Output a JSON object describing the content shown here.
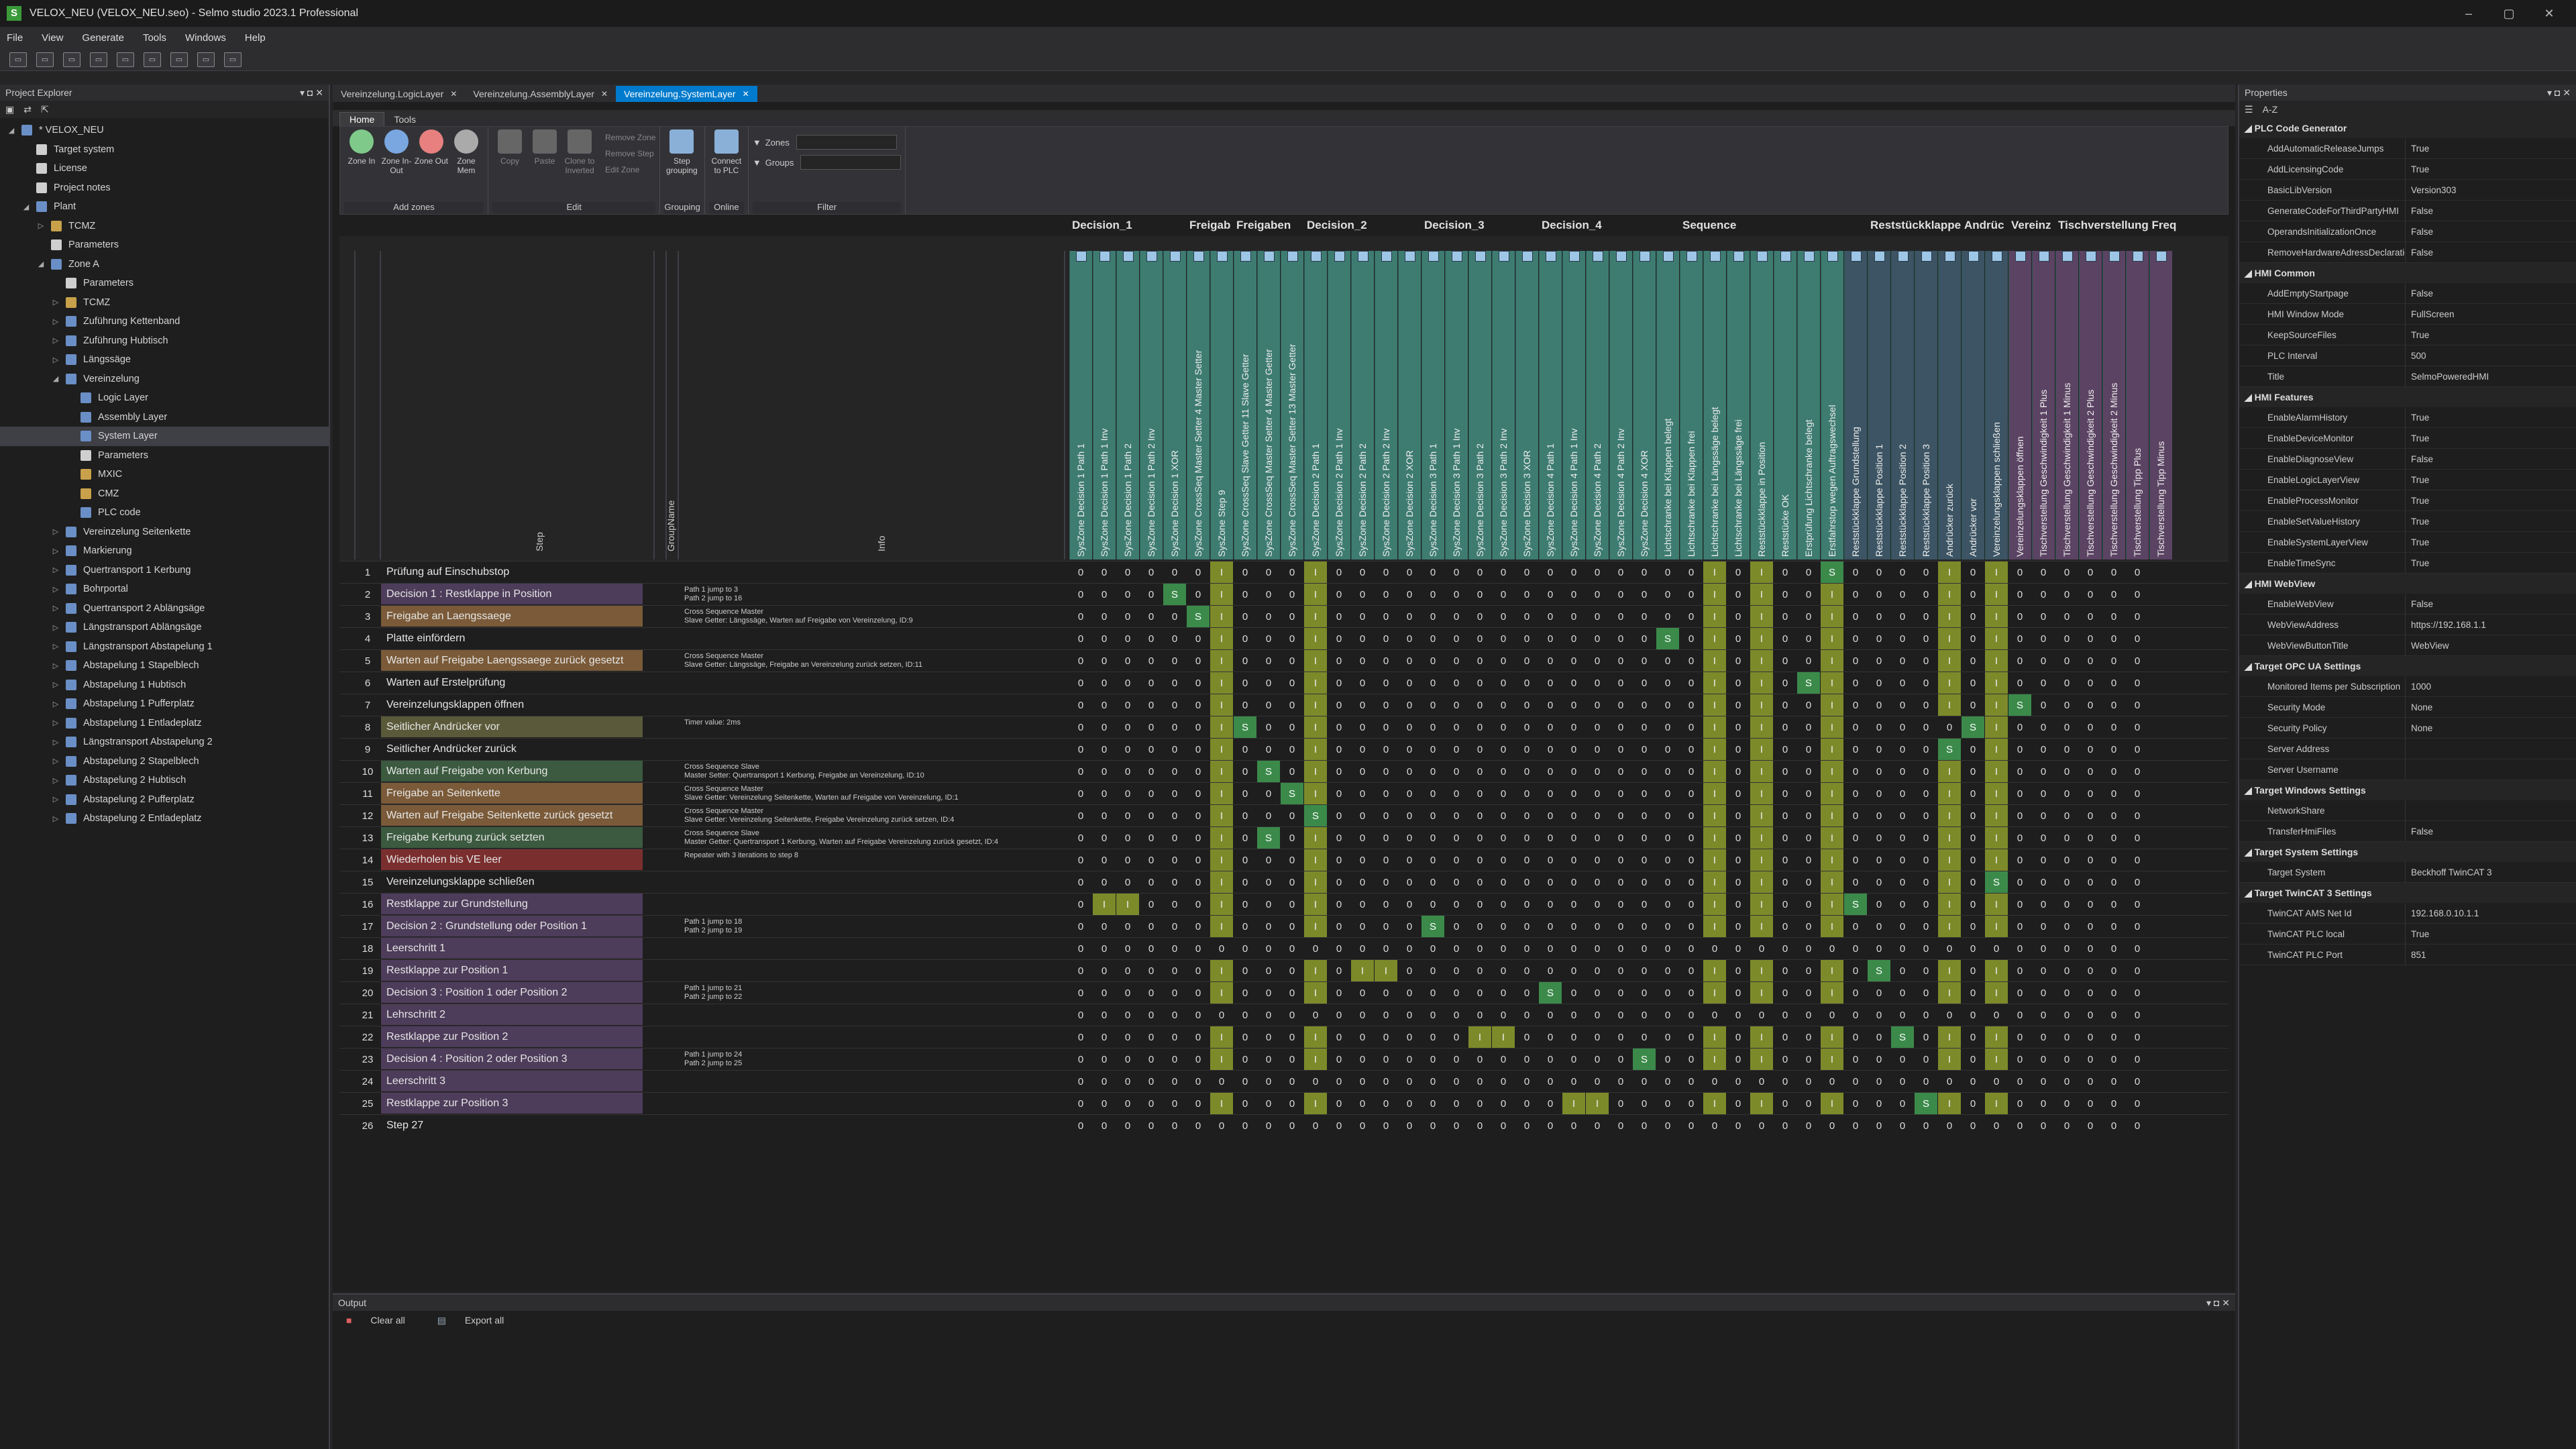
{
  "app": {
    "title": "VELOX_NEU (VELOX_NEU.seo) - Selmo studio 2023.1 Professional",
    "menu": [
      "File",
      "View",
      "Generate",
      "Tools",
      "Windows",
      "Help"
    ]
  },
  "explorer": {
    "title": "Project Explorer",
    "tree": [
      {
        "label": "* VELOX_NEU",
        "depth": 0,
        "icon": "project",
        "arrow": "expanded"
      },
      {
        "label": "Target system",
        "depth": 1,
        "icon": "doc"
      },
      {
        "label": "License",
        "depth": 1,
        "icon": "doc"
      },
      {
        "label": "Project notes",
        "depth": 1,
        "icon": "doc"
      },
      {
        "label": "Plant",
        "depth": 1,
        "icon": "plant",
        "arrow": "expanded"
      },
      {
        "label": "TCMZ",
        "depth": 2,
        "icon": "folder",
        "arrow": "collapsed"
      },
      {
        "label": "Parameters",
        "depth": 2,
        "icon": "sq"
      },
      {
        "label": "Zone A",
        "depth": 2,
        "icon": "zone",
        "arrow": "expanded"
      },
      {
        "label": "Parameters",
        "depth": 3,
        "icon": "sq"
      },
      {
        "label": "TCMZ",
        "depth": 3,
        "icon": "folder",
        "arrow": "collapsed"
      },
      {
        "label": "Zuführung Kettenband",
        "depth": 3,
        "icon": "zone",
        "arrow": "collapsed"
      },
      {
        "label": "Zuführung Hubtisch",
        "depth": 3,
        "icon": "zone",
        "arrow": "collapsed"
      },
      {
        "label": "Längssäge",
        "depth": 3,
        "icon": "zone",
        "arrow": "collapsed"
      },
      {
        "label": "Vereinzelung",
        "depth": 3,
        "icon": "zone",
        "arrow": "expanded"
      },
      {
        "label": "Logic Layer",
        "depth": 4,
        "icon": "layer"
      },
      {
        "label": "Assembly Layer",
        "depth": 4,
        "icon": "layer"
      },
      {
        "label": "System Layer",
        "depth": 4,
        "icon": "layer",
        "selected": true
      },
      {
        "label": "Parameters",
        "depth": 4,
        "icon": "sq"
      },
      {
        "label": "MXIC",
        "depth": 4,
        "icon": "folder"
      },
      {
        "label": "CMZ",
        "depth": 4,
        "icon": "folder"
      },
      {
        "label": "PLC code",
        "depth": 4,
        "icon": "layer"
      },
      {
        "label": "Vereinzelung Seitenkette",
        "depth": 3,
        "icon": "zone",
        "arrow": "collapsed"
      },
      {
        "label": "Markierung",
        "depth": 3,
        "icon": "zone",
        "arrow": "collapsed"
      },
      {
        "label": "Quertransport 1 Kerbung",
        "depth": 3,
        "icon": "zone",
        "arrow": "collapsed"
      },
      {
        "label": "Bohrportal",
        "depth": 3,
        "icon": "zone",
        "arrow": "collapsed"
      },
      {
        "label": "Quertransport 2 Ablängsäge",
        "depth": 3,
        "icon": "zone",
        "arrow": "collapsed"
      },
      {
        "label": "Längstransport Ablängsäge",
        "depth": 3,
        "icon": "zone",
        "arrow": "collapsed"
      },
      {
        "label": "Längstransport Abstapelung 1",
        "depth": 3,
        "icon": "zone",
        "arrow": "collapsed"
      },
      {
        "label": "Abstapelung 1 Stapelblech",
        "depth": 3,
        "icon": "zone",
        "arrow": "collapsed"
      },
      {
        "label": "Abstapelung 1 Hubtisch",
        "depth": 3,
        "icon": "zone",
        "arrow": "collapsed"
      },
      {
        "label": "Abstapelung 1 Pufferplatz",
        "depth": 3,
        "icon": "zone",
        "arrow": "collapsed"
      },
      {
        "label": "Abstapelung 1 Entladeplatz",
        "depth": 3,
        "icon": "zone",
        "arrow": "collapsed"
      },
      {
        "label": "Längstransport Abstapelung 2",
        "depth": 3,
        "icon": "zone",
        "arrow": "collapsed"
      },
      {
        "label": "Abstapelung 2 Stapelblech",
        "depth": 3,
        "icon": "zone",
        "arrow": "collapsed"
      },
      {
        "label": "Abstapelung 2 Hubtisch",
        "depth": 3,
        "icon": "zone",
        "arrow": "collapsed"
      },
      {
        "label": "Abstapelung 2 Pufferplatz",
        "depth": 3,
        "icon": "zone",
        "arrow": "collapsed"
      },
      {
        "label": "Abstapelung 2 Entladeplatz",
        "depth": 3,
        "icon": "zone",
        "arrow": "collapsed"
      }
    ]
  },
  "tabs": [
    {
      "label": "Vereinzelung.LogicLayer"
    },
    {
      "label": "Vereinzelung.AssemblyLayer"
    },
    {
      "label": "Vereinzelung.SystemLayer",
      "active": true
    }
  ],
  "ribbon": {
    "tabs": [
      "Home",
      "Tools"
    ],
    "groups": [
      {
        "label": "Add zones",
        "buttons": [
          {
            "label": "Zone In",
            "color": "#7fc98a"
          },
          {
            "label": "Zone In-Out",
            "color": "#7aa7e0"
          },
          {
            "label": "Zone Out",
            "color": "#e88080"
          },
          {
            "label": "Zone Mem",
            "color": "#aaaaaa"
          }
        ]
      },
      {
        "label": "Edit",
        "buttons": [
          {
            "label": "Copy",
            "color": "#666",
            "disabled": true
          },
          {
            "label": "Paste",
            "color": "#666",
            "disabled": true
          },
          {
            "label": "Clone to Inverted",
            "color": "#666",
            "disabled": true
          }
        ],
        "small": [
          "Remove Zone",
          "Remove Step",
          "Edit Zone"
        ]
      },
      {
        "label": "Grouping",
        "buttons": [
          {
            "label": "Step grouping",
            "color": "#8ab0d8"
          }
        ]
      },
      {
        "label": "Online",
        "buttons": [
          {
            "label": "Connect to PLC",
            "color": "#8ab0d8"
          }
        ]
      },
      {
        "label": "Filter",
        "filters": [
          "Zones",
          "Groups"
        ]
      }
    ]
  },
  "grid": {
    "header_cols": [
      "Step",
      "GroupName",
      "Info"
    ],
    "groups": [
      {
        "name": "Decision_1",
        "span": 5
      },
      {
        "name": "Freigab",
        "span": 2
      },
      {
        "name": "Freigaben",
        "span": 3
      },
      {
        "name": "Decision_2",
        "span": 5
      },
      {
        "name": "Decision_3",
        "span": 5
      },
      {
        "name": "Decision_4",
        "span": 6
      },
      {
        "name": "Sequence",
        "span": 8
      },
      {
        "name": "Reststückklappe",
        "span": 4
      },
      {
        "name": "Andrüc",
        "span": 2
      },
      {
        "name": "Vereinz",
        "span": 2
      },
      {
        "name": "Tischverstellung Freq",
        "span": 6
      }
    ],
    "columns": [
      "SysZone Decision 1 Path 1",
      "SysZone Decision 1 Path 1 Inv",
      "SysZone Decision 1 Path 2",
      "SysZone Decision 1 Path 2 Inv",
      "SysZone Decision 1 XOR",
      "SysZone CrossSeq Master Setter 4 Master Setter",
      "SysZone Step 9",
      "SysZone CrossSeq Slave Getter 11 Slave Getter",
      "SysZone CrossSeq Master Setter 4 Master Getter",
      "SysZone CrossSeq Master Setter 13 Master Getter",
      "SysZone Decision 2 Path 1",
      "SysZone Decision 2 Path 1 Inv",
      "SysZone Decision 2 Path 2",
      "SysZone Decision 2 Path 2 Inv",
      "SysZone Decision 2 XOR",
      "SysZone Decision 3 Path 1",
      "SysZone Decision 3 Path 1 Inv",
      "SysZone Decision 3 Path 2",
      "SysZone Decision 3 Path 2 Inv",
      "SysZone Decision 3 XOR",
      "SysZone Decision 4 Path 1",
      "SysZone Decision 4 Path 1 Inv",
      "SysZone Decision 4 Path 2",
      "SysZone Decision 4 Path 2 Inv",
      "SysZone Decision 4 XOR",
      "Lichtschranke bei Klappen belegt",
      "Lichtschranke bei Klappen frei",
      "Lichtschranke bei Längssäge belegt",
      "Lichtschranke bei Längssäge frei",
      "Reststückklappe in Position",
      "Reststücke OK",
      "Erstprüfung Lichtschranke belegt",
      "Erstfahrstop wegen Auftragswechsel",
      "Reststückklappe Grundstellung",
      "Reststückklappe Position 1",
      "Reststückklappe Position 2",
      "Reststückklappe Position 3",
      "Andrücker zurück",
      "Andrücker vor",
      "Vereinzelungsklappen schließen",
      "Vereinzelungsklappen öffnen",
      "Tischverstellung Geschwindigkeit 1 Plus",
      "Tischverstellung Geschwindigkeit 1 Minus",
      "Tischverstellung Geschwindigkeit 2 Plus",
      "Tischverstellung Geschwindigkeit 2 Minus",
      "Tischverstellung Tipp Plus",
      "Tischverstellung Tipp Minus"
    ],
    "steps": [
      {
        "n": "1",
        "step": "Prüfung auf Einschubstop",
        "kind": "plain",
        "info": "",
        "cells": "OOOOOOIOOOIOOOOOOOOOOOOOOOOIOIOOSOOOOIOIOOOOOO"
      },
      {
        "n": "2",
        "step": "Decision 1 : Restklappe in Position",
        "kind": "decision",
        "info": "Path 1 jump to 3|Path 2 jump to 16",
        "cells": "OOOOSOIOOOIOOOOOOOOOOOOOOOOIOIOOIOOOOIOIOOOOOO"
      },
      {
        "n": "3",
        "step": "Freigabe an Laengssaege",
        "kind": "orange",
        "info": "Cross Sequence Master|Slave Getter: Längssäge, Warten auf Freigabe von Vereinzelung, ID:9",
        "cells": "OOOOOSIOOOIOOOOOOOOOOOOOOOOIOIOOIOOOOIOIOOOOOO"
      },
      {
        "n": "4",
        "step": "Platte einfördern",
        "kind": "plain",
        "info": "",
        "cells": "OOOOOOIOOOIOOOOOOOOOOOOOOSOIOIOOIOOOOIOIOOOOOO"
      },
      {
        "n": "5",
        "step": "Warten auf Freigabe Laengssaege zurück gesetzt",
        "kind": "orange",
        "info": "Cross Sequence Master|Slave Getter: Längssäge, Freigabe an Vereinzelung zurück setzen, ID:11",
        "cells": "OOOOOOIOOOIOOOOOOOOOOOOOOOOIOIOOIOOOOIOIOOOOOO"
      },
      {
        "n": "6",
        "step": "Warten auf Erstelprüfung",
        "kind": "plain",
        "info": "",
        "cells": "OOOOOOIOOOIOOOOOOOOOOOOOOOOIOIOSIOOOOIOIOOOOOO"
      },
      {
        "n": "7",
        "step": "Vereinzelungsklappen öffnen",
        "kind": "plain",
        "info": "",
        "cells": "OOOOOOIOOOIOOOOOOOOOOOOOOOOIOIOOIOOOOIOISOOOOO"
      },
      {
        "n": "8",
        "step": "Seitlicher Andrücker vor",
        "kind": "olive",
        "info": "Timer value: 2ms",
        "cells": "OOOOOOISOOIOOOOOOOOOOOOOOOOIOIOOIOOOOOSIOOOOOO"
      },
      {
        "n": "9",
        "step": "Seitlicher Andrücker zurück",
        "kind": "plain",
        "info": "",
        "cells": "OOOOOOIOOOIOOOOOOOOOOOOOOOOIOIOOIOOOOSOIOOOOOO"
      },
      {
        "n": "10",
        "step": "Warten auf Freigabe von Kerbung",
        "kind": "green",
        "info": "Cross Sequence Slave|Master Setter: Quertransport 1 Kerbung, Freigabe an Vereinzelung, ID:10",
        "cells": "OOOOOOIOSOIOOOOOOOOOOOOOOOOIOIOOIOOOOIOIOOOOOO"
      },
      {
        "n": "11",
        "step": "Freigabe an Seitenkette",
        "kind": "orange",
        "info": "Cross Sequence Master|Slave Getter: Vereinzelung Seitenkette, Warten auf Freigabe von Vereinzelung, ID:1",
        "cells": "OOOOOOIOOSIOOOOOOOOOOOOOOOOIOIOOIOOOOIOIOOOOOO"
      },
      {
        "n": "12",
        "step": "Warten auf Freigabe Seitenkette zurück gesetzt",
        "kind": "orange",
        "info": "Cross Sequence Master|Slave Getter: Vereinzelung Seitenkette, Freigabe Vereinzelung zurück setzen, ID:4",
        "cells": "OOOOOOIOOOSOOOOOOOOOOOOOOOOIOIOOIOOOOIOIOOOOOO"
      },
      {
        "n": "13",
        "step": "Freigabe Kerbung zurück setzten",
        "kind": "green",
        "info": "Cross Sequence Slave|Master Getter: Quertransport 1 Kerbung, Warten auf Freigabe Vereinzelung zurück gesetzt, ID:4",
        "cells": "OOOOOOIOSOIOOOOOOOOOOOOOOOOIOIOOIOOOOIOIOOOOOO"
      },
      {
        "n": "14",
        "step": "Wiederholen bis VE leer",
        "kind": "red",
        "info": "Repeater with 3 iterations to step 8",
        "cells": "OOOOOOIOOOIOOOOOOOOOOOOOOOOIOIOOIOOOOIOIOOOOOO"
      },
      {
        "n": "15",
        "step": "Vereinzelungsklappe schließen",
        "kind": "plain",
        "info": "",
        "cells": "OOOOOOIOOOIOOOOOOOOOOOOOOOOIOIOOIOOOOIOSOOOOOO"
      },
      {
        "n": "16",
        "step": "Restklappe zur Grundstellung",
        "kind": "purple",
        "info": "",
        "cells": "OIIOOOIOOOIOOOOOOOOOOOOOOOOIOIOOISOOOIOIOOOOOO"
      },
      {
        "n": "17",
        "step": "Decision 2 : Grundstellung oder Position 1",
        "kind": "decision",
        "info": "Path 1 jump to 18|Path 2 jump to 19",
        "cells": "OOOOOOIOOOIOOOOSOOOOOOOOOOOIOIOOIOOOOIOIOOOOOO"
      },
      {
        "n": "18",
        "step": "Leerschritt 1",
        "kind": "purple",
        "info": "",
        "cells": "OOOOOOOOOOOOOOOOOOOOOOOOOOOOOOOOOOOOOOOOOOOOOO"
      },
      {
        "n": "19",
        "step": "Restklappe zur Position 1",
        "kind": "purple",
        "info": "",
        "cells": "OOOOOOIOOOIOIIOOOOOOOOOOOOOIOIOOIOSOOIOIOOOOOO"
      },
      {
        "n": "20",
        "step": "Decision 3 : Position 1 oder Position 2",
        "kind": "decision",
        "info": "Path 1 jump to 21|Path 2 jump to 22",
        "cells": "OOOOOOIOOOIOOOOOOOOOSOOOOOOIOIOOIOOOOIOIOOOOOO"
      },
      {
        "n": "21",
        "step": "Lehrschritt 2",
        "kind": "purple",
        "info": "",
        "cells": "OOOOOOOOOOOOOOOOOOOOOOOOOOOOOOOOOOOOOOOOOOOOOO"
      },
      {
        "n": "22",
        "step": "Restklappe zur Position 2",
        "kind": "purple",
        "info": "",
        "cells": "OOOOOOIOOOIOOOOOOIIOOOOOOOOIOIOOIOOSOIOIOOOOOO"
      },
      {
        "n": "23",
        "step": "Decision 4 : Position 2 oder Position 3",
        "kind": "decision",
        "info": "Path 1 jump to 24|Path 2 jump to 25",
        "cells": "OOOOOOIOOOIOOOOOOOOOOOOOSOOIOIOOIOOOOIOIOOOOOO"
      },
      {
        "n": "24",
        "step": "Leerschritt 3",
        "kind": "purple",
        "info": "",
        "cells": "OOOOOOOOOOOOOOOOOOOOOOOOOOOOOOOOOOOOOOOOOOOOOO"
      },
      {
        "n": "25",
        "step": "Restklappe zur Position 3",
        "kind": "purple",
        "info": "",
        "cells": "OOOOOOIOOOIOOOOOOOOOOIIOOOOIOIOOIOOOSIOIOOOOOO"
      },
      {
        "n": "26",
        "step": "Step 27",
        "kind": "plain",
        "info": "",
        "cells": "OOOOOOOOOOOOOOOOOOOOOOOOOOOOOOOOOOOOOOOOOOOOOO"
      }
    ]
  },
  "properties": {
    "title": "Properties",
    "sort": "A-Z",
    "categories": [
      {
        "name": "PLC Code Generator",
        "items": [
          [
            "AddAutomaticReleaseJumps",
            "True"
          ],
          [
            "AddLicensingCode",
            "True"
          ],
          [
            "BasicLibVersion",
            "Version303"
          ],
          [
            "GenerateCodeForThirdPartyHMI",
            "False"
          ],
          [
            "OperandsInitializationOnce",
            "False"
          ],
          [
            "RemoveHardwareAdressDeclarations",
            "False"
          ]
        ]
      },
      {
        "name": "HMI Common",
        "items": [
          [
            "AddEmptyStartpage",
            "False"
          ],
          [
            "HMI Window Mode",
            "FullScreen"
          ],
          [
            "KeepSourceFiles",
            "True"
          ],
          [
            "PLC Interval",
            "500"
          ],
          [
            "Title",
            "SelmoPoweredHMI"
          ]
        ]
      },
      {
        "name": "HMI Features",
        "items": [
          [
            "EnableAlarmHistory",
            "True"
          ],
          [
            "EnableDeviceMonitor",
            "True"
          ],
          [
            "EnableDiagnoseView",
            "False"
          ],
          [
            "EnableLogicLayerView",
            "True"
          ],
          [
            "EnableProcessMonitor",
            "True"
          ],
          [
            "EnableSetValueHistory",
            "True"
          ],
          [
            "EnableSystemLayerView",
            "True"
          ],
          [
            "EnableTimeSync",
            "True"
          ]
        ]
      },
      {
        "name": "HMI WebView",
        "items": [
          [
            "EnableWebView",
            "False"
          ],
          [
            "WebViewAddress",
            "https://192.168.1.1"
          ],
          [
            "WebViewButtonTitle",
            "WebView"
          ]
        ]
      },
      {
        "name": "Target OPC UA Settings",
        "items": [
          [
            "Monitored Items per Subscription",
            "1000"
          ],
          [
            "Security Mode",
            "None"
          ],
          [
            "Security Policy",
            "None"
          ],
          [
            "Server Address",
            ""
          ],
          [
            "Server Username",
            ""
          ]
        ]
      },
      {
        "name": "Target Windows Settings",
        "items": [
          [
            "NetworkShare",
            ""
          ],
          [
            "TransferHmiFiles",
            "False"
          ]
        ]
      },
      {
        "name": "Target System Settings",
        "items": [
          [
            "Target System",
            "Beckhoff TwinCAT 3"
          ]
        ]
      },
      {
        "name": "Target TwinCAT 3 Settings",
        "items": [
          [
            "TwinCAT AMS Net Id",
            "192.168.0.10.1.1"
          ],
          [
            "TwinCAT PLC local",
            "True"
          ],
          [
            "TwinCAT PLC Port",
            "851"
          ]
        ]
      }
    ]
  },
  "output": {
    "title": "Output",
    "clear": "Clear all",
    "export": "Export all"
  },
  "colors": {
    "accent": "#007acc",
    "zone_green": "#3e7c72",
    "cell_I": "#7d8a2a",
    "cell_S": "#3b8a4a",
    "step_orange": "#7a5a38",
    "step_green": "#3b5a3f",
    "step_purple": "#4d3c5a",
    "step_red": "#7a2e2e",
    "step_olive": "#5a5a3a"
  }
}
